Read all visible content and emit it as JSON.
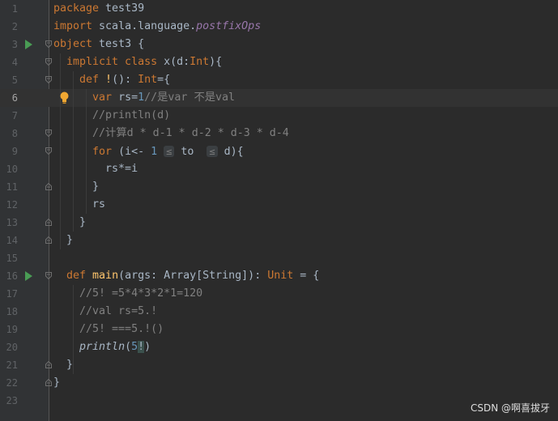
{
  "editor": {
    "current_line": 6,
    "lines": [
      {
        "n": "1",
        "run": false,
        "fold": "",
        "tokens": [
          {
            "t": "package ",
            "c": "kw"
          },
          {
            "t": "test39",
            "c": ""
          }
        ]
      },
      {
        "n": "2",
        "run": false,
        "fold": "",
        "tokens": [
          {
            "t": "import ",
            "c": "kw"
          },
          {
            "t": "scala.language.",
            "c": ""
          },
          {
            "t": "postfixOps",
            "c": "pf"
          }
        ]
      },
      {
        "n": "3",
        "run": true,
        "fold": "open",
        "tokens": [
          {
            "t": "object ",
            "c": "kw"
          },
          {
            "t": "test3 {",
            "c": ""
          }
        ]
      },
      {
        "n": "4",
        "run": false,
        "fold": "open",
        "tokens": [
          {
            "t": "  implicit class ",
            "c": "kw"
          },
          {
            "t": "x(d:",
            "c": ""
          },
          {
            "t": "Int",
            "c": "kw"
          },
          {
            "t": "){",
            "c": ""
          }
        ]
      },
      {
        "n": "5",
        "run": false,
        "fold": "open",
        "tokens": [
          {
            "t": "    def ",
            "c": "kw"
          },
          {
            "t": "!",
            "c": "fn"
          },
          {
            "t": "(): ",
            "c": ""
          },
          {
            "t": "Int",
            "c": "kw"
          },
          {
            "t": "={",
            "c": ""
          }
        ]
      },
      {
        "n": "6",
        "run": false,
        "fold": "",
        "bulb": true,
        "tokens": [
          {
            "t": "      var ",
            "c": "kw"
          },
          {
            "t": "rs=",
            "c": ""
          },
          {
            "t": "1",
            "c": "num"
          },
          {
            "t": "//是var 不是val",
            "c": "cmt"
          }
        ]
      },
      {
        "n": "7",
        "run": false,
        "fold": "",
        "tokens": [
          {
            "t": "      //println(d)",
            "c": "cmt"
          }
        ]
      },
      {
        "n": "8",
        "run": false,
        "fold": "open",
        "tokens": [
          {
            "t": "      //计算d * d-1 * d-2 * d-3 * d-4",
            "c": "cmt"
          }
        ]
      },
      {
        "n": "9",
        "run": false,
        "fold": "open",
        "tokens": [
          {
            "t": "      for ",
            "c": "kw"
          },
          {
            "t": "(i<- ",
            "c": ""
          },
          {
            "t": "1",
            "c": "num"
          },
          {
            "t": " ",
            "c": ""
          },
          {
            "t": "≤",
            "c": "hint"
          },
          {
            "t": " to  ",
            "c": ""
          },
          {
            "t": "≤",
            "c": "hint"
          },
          {
            "t": " d){",
            "c": ""
          }
        ]
      },
      {
        "n": "10",
        "run": false,
        "fold": "",
        "tokens": [
          {
            "t": "        rs*=i",
            "c": ""
          }
        ]
      },
      {
        "n": "11",
        "run": false,
        "fold": "close",
        "tokens": [
          {
            "t": "      }",
            "c": ""
          }
        ]
      },
      {
        "n": "12",
        "run": false,
        "fold": "",
        "tokens": [
          {
            "t": "      rs",
            "c": ""
          }
        ]
      },
      {
        "n": "13",
        "run": false,
        "fold": "close",
        "tokens": [
          {
            "t": "    }",
            "c": ""
          }
        ]
      },
      {
        "n": "14",
        "run": false,
        "fold": "close",
        "tokens": [
          {
            "t": "  }",
            "c": ""
          }
        ]
      },
      {
        "n": "15",
        "run": false,
        "fold": "",
        "tokens": [
          {
            "t": "",
            "c": ""
          }
        ]
      },
      {
        "n": "16",
        "run": true,
        "fold": "open",
        "tokens": [
          {
            "t": "  def ",
            "c": "kw"
          },
          {
            "t": "main",
            "c": "fn"
          },
          {
            "t": "(args: Array[String]): ",
            "c": ""
          },
          {
            "t": "Unit",
            "c": "kw"
          },
          {
            "t": " = {",
            "c": ""
          }
        ]
      },
      {
        "n": "17",
        "run": false,
        "fold": "",
        "tokens": [
          {
            "t": "    //5! =5*4*3*2*1=120",
            "c": "cmt"
          }
        ]
      },
      {
        "n": "18",
        "run": false,
        "fold": "",
        "tokens": [
          {
            "t": "    //val rs=5.!",
            "c": "cmt"
          }
        ]
      },
      {
        "n": "19",
        "run": false,
        "fold": "",
        "tokens": [
          {
            "t": "    //5! ===5.!()",
            "c": "cmt"
          }
        ]
      },
      {
        "n": "20",
        "run": false,
        "fold": "",
        "tokens": [
          {
            "t": "    ",
            "c": ""
          },
          {
            "t": "println",
            "c": "it"
          },
          {
            "t": "(",
            "c": ""
          },
          {
            "t": "5",
            "c": "num"
          },
          {
            "t": "!",
            "c": "hl"
          },
          {
            "t": ")",
            "c": ""
          }
        ]
      },
      {
        "n": "21",
        "run": false,
        "fold": "close",
        "tokens": [
          {
            "t": "  }",
            "c": ""
          }
        ]
      },
      {
        "n": "22",
        "run": false,
        "fold": "close",
        "tokens": [
          {
            "t": "}",
            "c": ""
          }
        ]
      },
      {
        "n": "23",
        "run": false,
        "fold": "",
        "tokens": [
          {
            "t": "",
            "c": ""
          }
        ]
      }
    ]
  },
  "watermark": "CSDN @啊喜拔牙",
  "colors": {
    "background": "#2b2b2b",
    "keyword": "#cc7832",
    "function": "#ffc66d",
    "number": "#6897bb",
    "comment": "#808080"
  },
  "icons": {
    "run": "run-gutter-icon",
    "fold": "fold-marker-icon",
    "bulb": "intention-bulb-icon"
  }
}
